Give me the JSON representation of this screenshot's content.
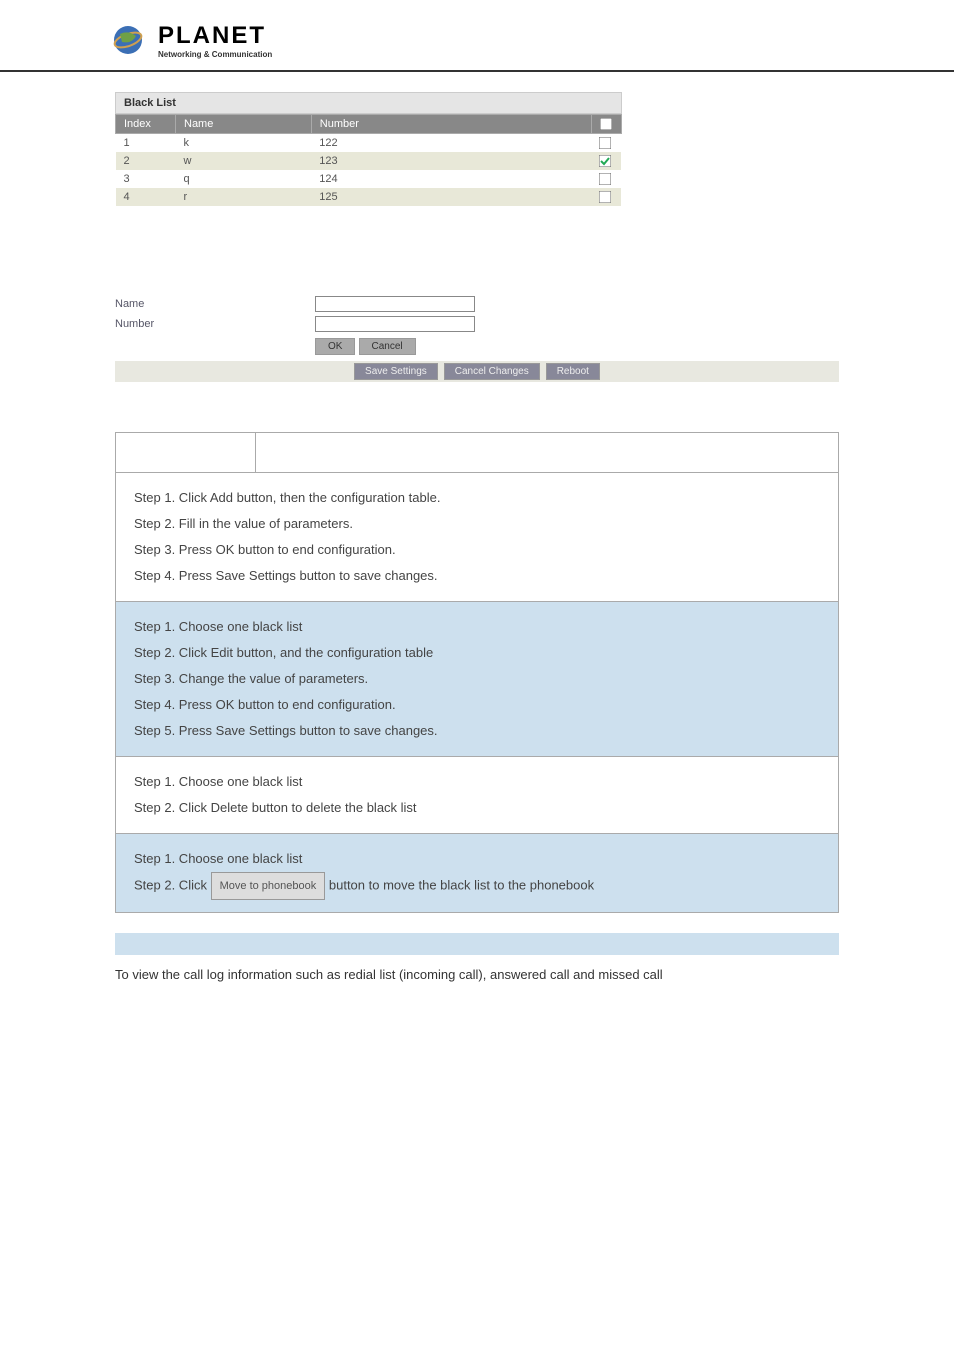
{
  "logo": {
    "title": "PLANET",
    "subtitle": "Networking & Communication"
  },
  "blacklist": {
    "section_title": "Black List",
    "headers": {
      "index": "Index",
      "name": "Name",
      "number": "Number"
    },
    "rows": [
      {
        "index": "1",
        "name": "k",
        "number": "122",
        "checked": false
      },
      {
        "index": "2",
        "name": "w",
        "number": "123",
        "checked": true
      },
      {
        "index": "3",
        "name": "q",
        "number": "124",
        "checked": false
      },
      {
        "index": "4",
        "name": "r",
        "number": "125",
        "checked": false
      }
    ]
  },
  "form": {
    "name_label": "Name",
    "number_label": "Number",
    "ok_label": "OK",
    "cancel_label": "Cancel",
    "save_label": "Save Settings",
    "cancel_changes_label": "Cancel Changes",
    "reboot_label": "Reboot"
  },
  "instructions": {
    "add": [
      "Step 1. Click Add button, then the configuration table.",
      "Step 2. Fill in the value of parameters.",
      "Step 3. Press OK button to end configuration.",
      "Step 4. Press Save Settings button to save changes."
    ],
    "edit": [
      "Step 1. Choose one black list",
      "Step 2. Click Edit button, and the configuration table",
      "Step 3. Change the value of parameters.",
      "Step 4. Press OK button to end configuration.",
      "Step 5. Press Save Settings button to save changes."
    ],
    "delete": [
      "Step 1. Choose one black list",
      "Step 2. Click Delete button to delete the black list"
    ],
    "move_pre": "Step 1. Choose one black list",
    "move_click": "Step 2. Click",
    "move_btn": "Move to phonebook",
    "move_after": "button to move the black list to the phonebook"
  },
  "bottom_text": "To view the call log information such as redial list (incoming call), answered call and missed call"
}
